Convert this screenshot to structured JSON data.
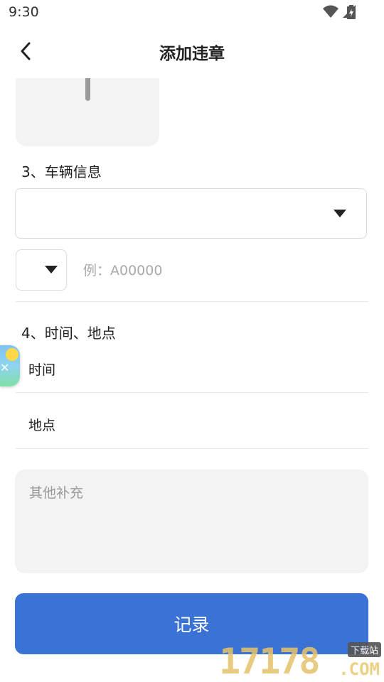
{
  "status_bar": {
    "time": "9:30"
  },
  "app_bar": {
    "title": "添加违章"
  },
  "sections": {
    "vehicle": {
      "label": "3、车辆信息",
      "plate_placeholder": "例：A00000"
    },
    "time_place": {
      "label": "4、时间、地点",
      "time_label": "时间",
      "place_label": "地点"
    }
  },
  "notes": {
    "placeholder": "其他补充"
  },
  "actions": {
    "record_label": "记录"
  },
  "watermark": {
    "digits": "17178",
    "suffix": ".COM",
    "badge": "下载站"
  },
  "colors": {
    "primary": "#3a73d4",
    "field_bg": "#f3f3f3",
    "border": "#dcdcdc"
  }
}
